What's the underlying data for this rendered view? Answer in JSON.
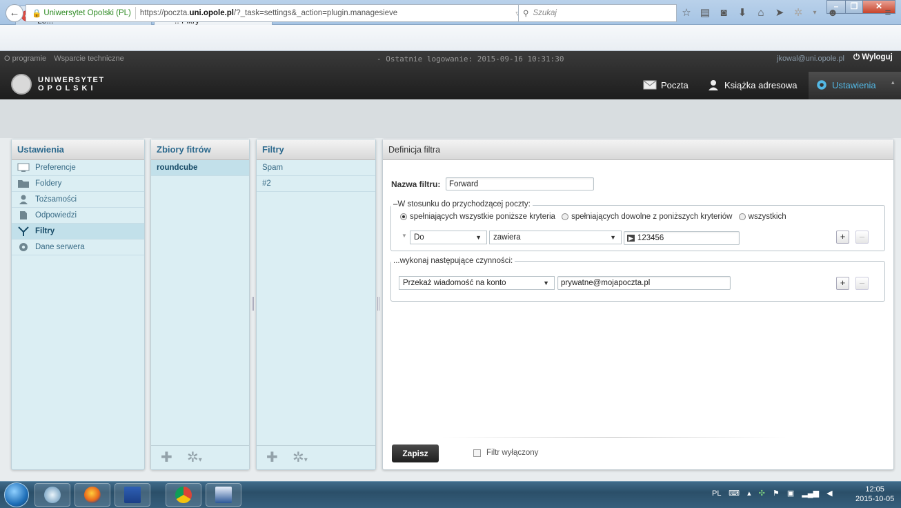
{
  "browser": {
    "tabs": [
      {
        "label": "Uniwersytet Opolski - e-Le...",
        "active": false
      },
      {
        "label": "Roundcube Webmail :: Filtry",
        "active": true
      }
    ],
    "url_secure_label": "Uniwersytet Opolski (PL)",
    "url_prefix": "https://poczta.",
    "url_domain": "uni.opole.pl",
    "url_path": "/?_task=settings&_action=plugin.managesieve",
    "search_placeholder": "Szukaj"
  },
  "header": {
    "links": [
      "O programie",
      "Wsparcie techniczne"
    ],
    "last_login": "- Ostatnie logowanie: 2015-09-16 10:31:30",
    "user_email": "jkowal@uni.opole.pl",
    "logout_label": "Wyloguj",
    "logo_line1": "UNIWERSYTET",
    "logo_line2": "OPOLSKI",
    "nav": [
      {
        "label": "Poczta",
        "icon": "mail-icon"
      },
      {
        "label": "Książka adresowa",
        "icon": "person-icon"
      },
      {
        "label": "Ustawienia",
        "icon": "gear-icon"
      }
    ]
  },
  "settings_panel": {
    "title": "Ustawienia",
    "items": [
      {
        "label": "Preferencje",
        "icon": "monitor-icon"
      },
      {
        "label": "Foldery",
        "icon": "folder-icon"
      },
      {
        "label": "Tożsamości",
        "icon": "person-icon"
      },
      {
        "label": "Odpowiedzi",
        "icon": "document-icon"
      },
      {
        "label": "Filtry",
        "icon": "filter-icon",
        "selected": true
      },
      {
        "label": "Dane serwera",
        "icon": "gear-icon"
      }
    ]
  },
  "filtersets_panel": {
    "title": "Zbiory fitrów",
    "items": [
      {
        "label": "roundcube",
        "selected": true
      }
    ]
  },
  "filters_panel": {
    "title": "Filtry",
    "items": [
      {
        "label": "Spam"
      },
      {
        "label": "#2"
      }
    ]
  },
  "definition": {
    "title": "Definicja filtra",
    "name_label": "Nazwa filtru:",
    "name_value": "Forward",
    "rules_legend": "W stosunku do przychodzącej poczty:",
    "radio_all": "spełniających wszystkie poniższe kryteria",
    "radio_any": "spełniających dowolne z poniższych kryteriów",
    "radio_everything": "wszystkich",
    "rule_header": "Do",
    "rule_op": "zawiera",
    "rule_value": "123456",
    "actions_legend": "...wykonaj następujące czynności:",
    "action_type": "Przekaż wiadomość na konto",
    "action_value": "prywatne@mojapoczta.pl",
    "save_label": "Zapisz",
    "disabled_label": "Filtr wyłączony"
  },
  "taskbar": {
    "lang": "PL",
    "time": "12:05",
    "date": "2015-10-05"
  },
  "colors": {
    "accent": "#2d6a8e",
    "panel_bg": "#dbeef3",
    "header_bg": "#2c2c2c",
    "settings_active": "#53b9e6"
  }
}
